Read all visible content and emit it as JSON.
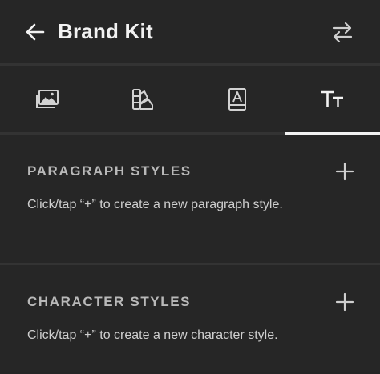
{
  "header": {
    "title": "Brand Kit",
    "back_icon": "arrow-left-icon",
    "swap_icon": "swap-arrows-icon"
  },
  "tabs": [
    {
      "icon": "image-icon",
      "active": false
    },
    {
      "icon": "color-swatch-icon",
      "active": false
    },
    {
      "icon": "logo-book-icon",
      "active": false
    },
    {
      "icon": "text-styles-icon",
      "active": true
    }
  ],
  "paragraph": {
    "title": "PARAGRAPH STYLES",
    "hint": "Click/tap “+” to create a new paragraph style."
  },
  "character": {
    "title": "CHARACTER STYLES",
    "hint": "Click/tap “+” to create a new character style."
  },
  "colors": {
    "background": "#262626",
    "divider": "#333333",
    "text": "#f2f2f2",
    "muted": "#b9b9b9"
  }
}
